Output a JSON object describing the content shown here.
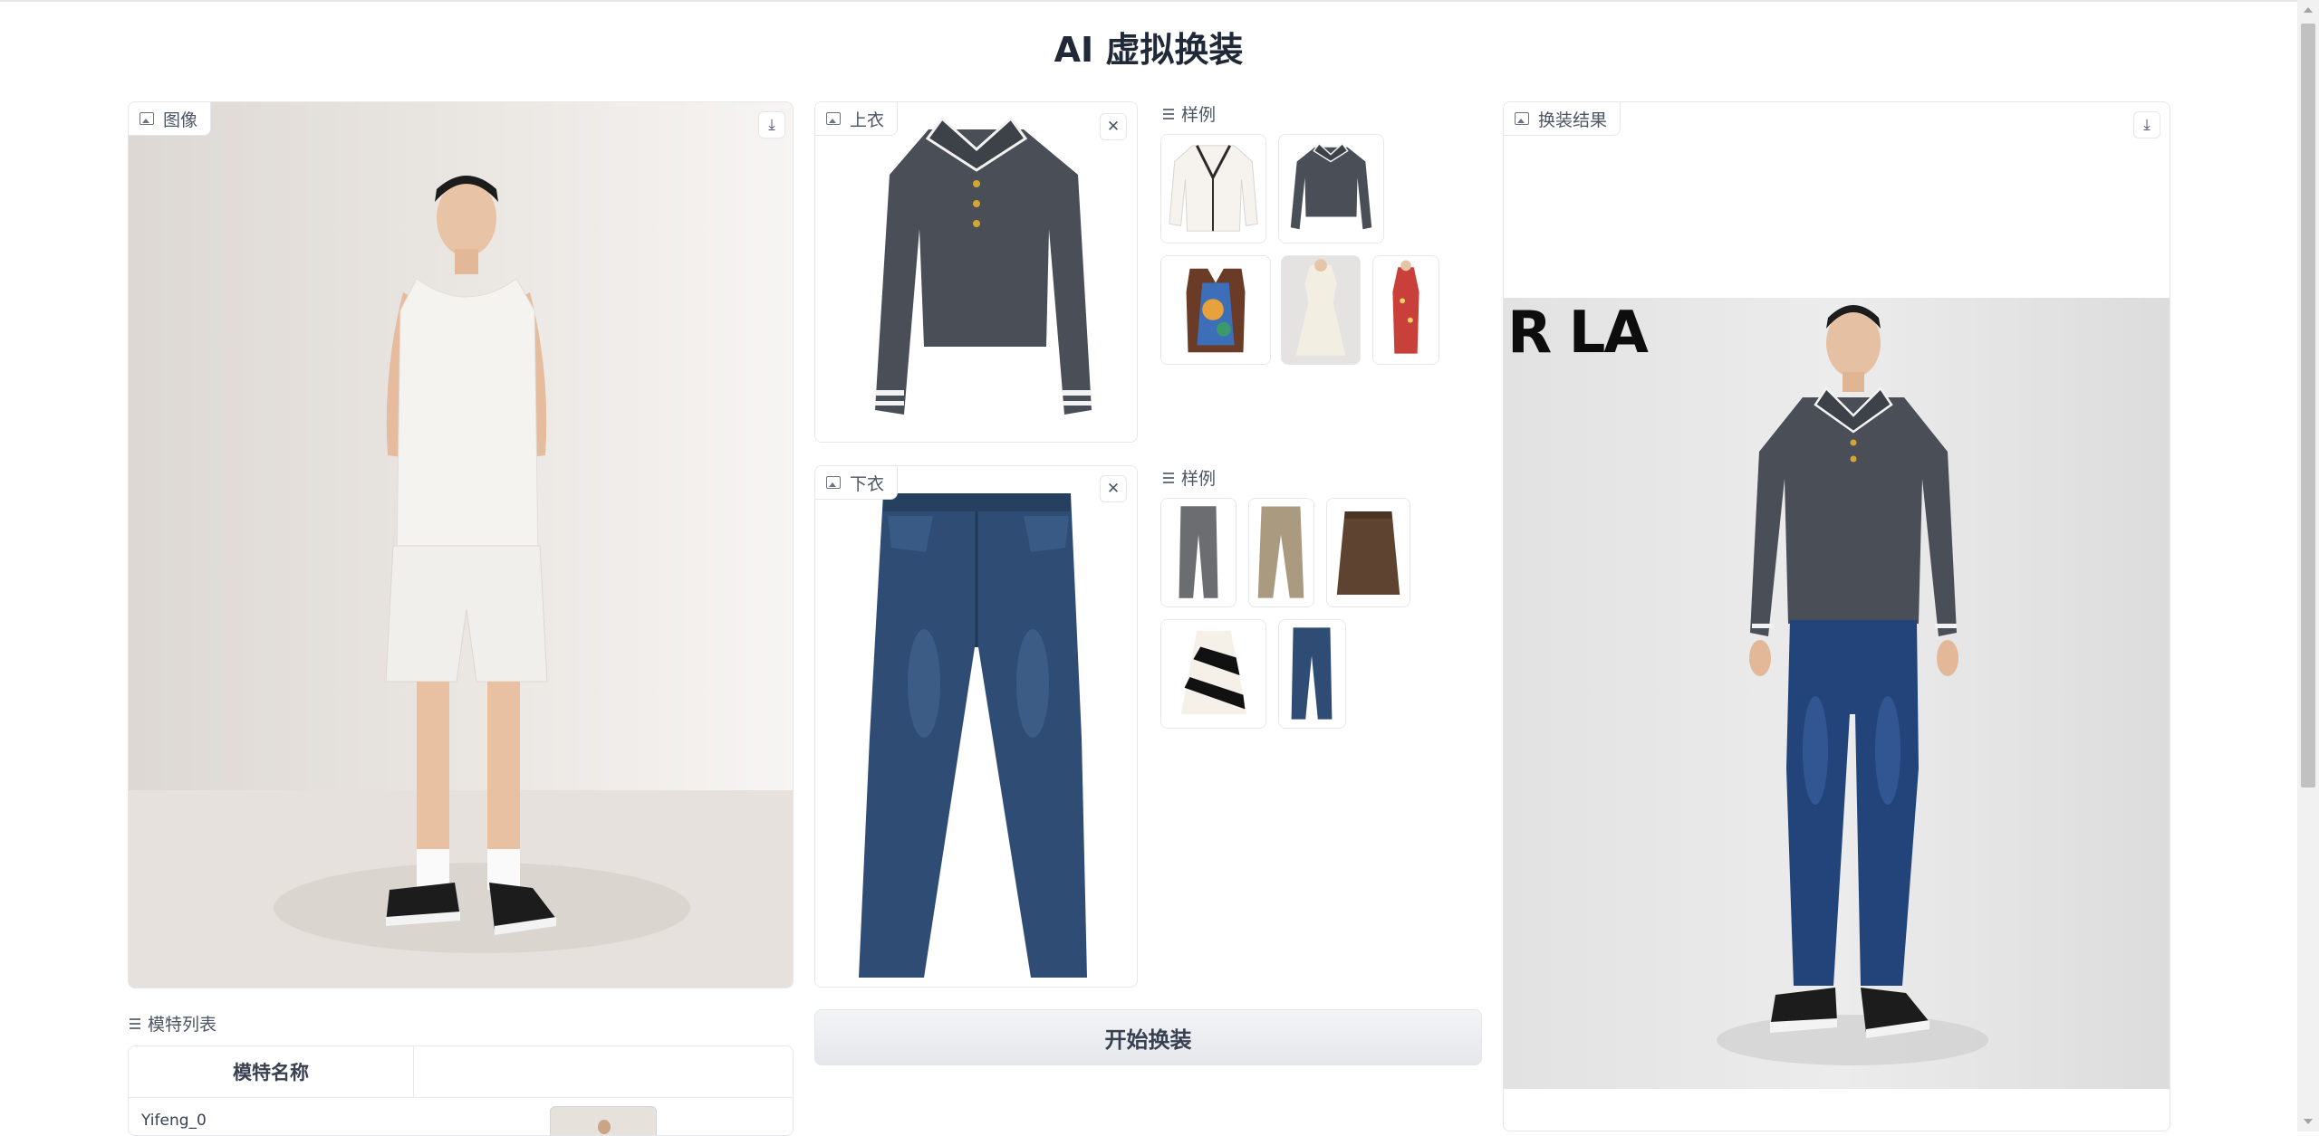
{
  "page": {
    "title": "AI 虚拟换装"
  },
  "image_panel": {
    "label": "图像",
    "download_icon": "download-icon"
  },
  "top_panel": {
    "label": "上衣",
    "close_icon": "close-icon"
  },
  "top_examples": {
    "label": "样例",
    "items": [
      "white-cardigan",
      "gray-polo-sweater",
      "floral-vest",
      "cream-dress",
      "red-floral-dress"
    ]
  },
  "bottom_panel": {
    "label": "下衣",
    "close_icon": "close-icon"
  },
  "bottom_examples": {
    "label": "样例",
    "items": [
      "gray-trousers",
      "beige-trousers",
      "brown-skirt",
      "striped-skirt",
      "blue-jeans"
    ]
  },
  "result_panel": {
    "label": "换装结果",
    "download_icon": "download-icon",
    "background_text": "R LA"
  },
  "start_button": {
    "label": "开始换装"
  },
  "model_list": {
    "label": "模特列表",
    "columns": [
      "模特名称",
      ""
    ],
    "rows": [
      {
        "name": "Yifeng_0"
      }
    ]
  },
  "colors": {
    "border": "#e5e7eb",
    "text": "#1f2937",
    "button_bg": "#e5e7eb"
  }
}
